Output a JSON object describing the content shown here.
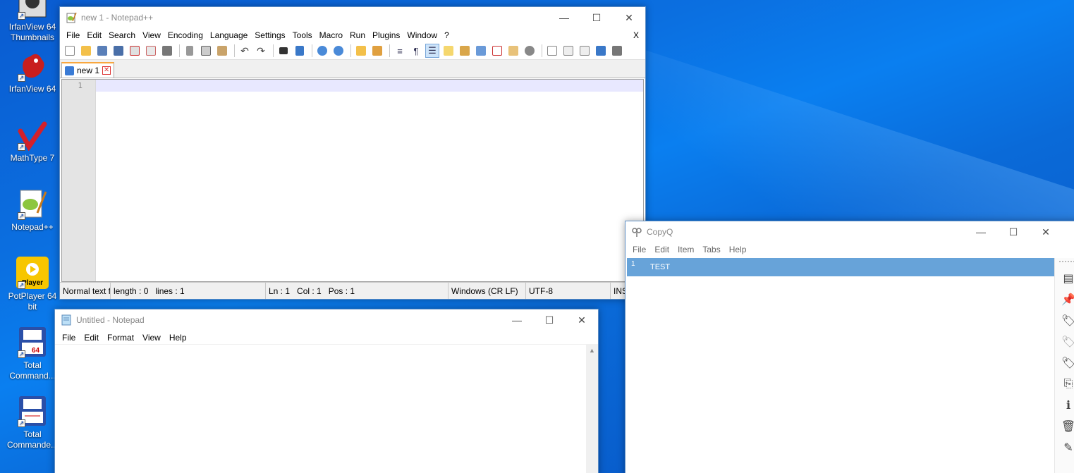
{
  "desktop": {
    "icons": [
      {
        "label": "IrfanView 64 Thumbnails"
      },
      {
        "label": "IrfanView 64"
      },
      {
        "label": "MathType 7"
      },
      {
        "label": "Notepad++"
      },
      {
        "label": "PotPlayer 64 bit",
        "badge": "Player"
      },
      {
        "label": "Total Command...",
        "badge": "64"
      },
      {
        "label": "Total Commande..."
      }
    ]
  },
  "npp": {
    "title": "new 1 - Notepad++",
    "menu": [
      "File",
      "Edit",
      "Search",
      "View",
      "Encoding",
      "Language",
      "Settings",
      "Tools",
      "Macro",
      "Run",
      "Plugins",
      "Window",
      "?"
    ],
    "menu_close": "X",
    "tab_label": "new 1",
    "line_number": "1",
    "status": {
      "lang": "Normal text f",
      "length": "length : 0",
      "lines": "lines : 1",
      "ln": "Ln : 1",
      "col": "Col : 1",
      "pos": "Pos : 1",
      "eol": "Windows (CR LF)",
      "encoding": "UTF-8",
      "mode": "INS"
    }
  },
  "notepad": {
    "title": "Untitled - Notepad",
    "menu": [
      "File",
      "Edit",
      "Format",
      "View",
      "Help"
    ]
  },
  "copyq": {
    "title": "CopyQ",
    "menu": [
      "File",
      "Edit",
      "Item",
      "Tabs",
      "Help"
    ],
    "items": [
      {
        "index": "1",
        "text": "TEST"
      }
    ]
  },
  "colors": {
    "desktop": "#0a6ad8",
    "selection": "#67a3d9",
    "current_line": "#e8e8ff"
  }
}
